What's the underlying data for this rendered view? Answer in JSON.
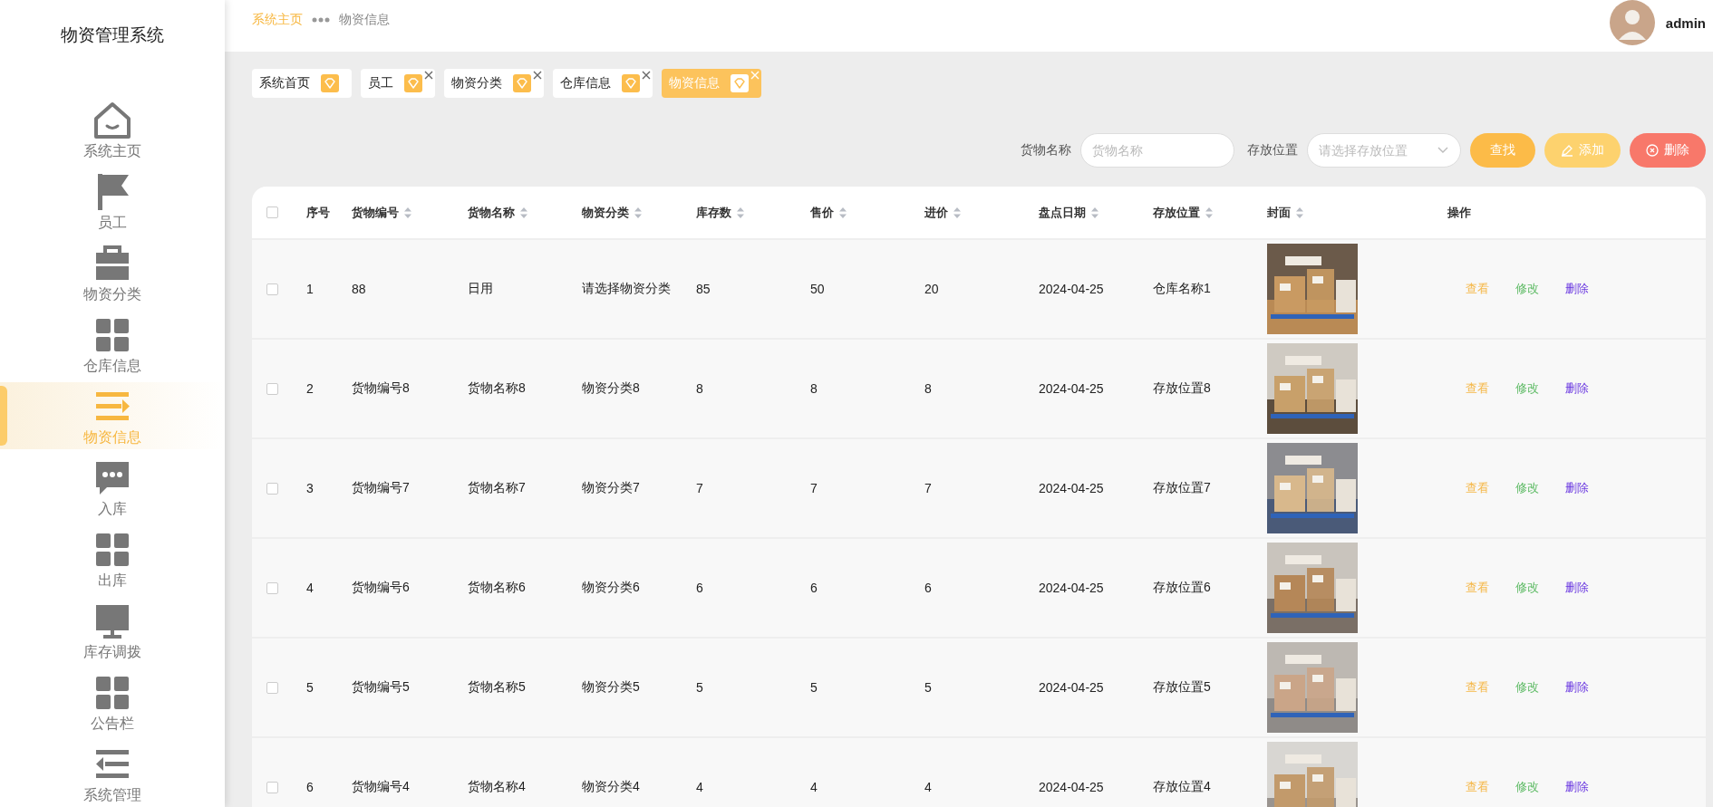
{
  "sidebar": {
    "title": "物资管理系统",
    "items": [
      {
        "label": "系统主页",
        "selected": false
      },
      {
        "label": "员工",
        "selected": false
      },
      {
        "label": "物资分类",
        "selected": false
      },
      {
        "label": "仓库信息",
        "selected": false
      },
      {
        "label": "物资信息",
        "selected": true
      },
      {
        "label": "入库",
        "selected": false
      },
      {
        "label": "出库",
        "selected": false
      },
      {
        "label": "库存调拨",
        "selected": false
      },
      {
        "label": "公告栏",
        "selected": false
      },
      {
        "label": "系统管理",
        "selected": false
      }
    ]
  },
  "breadcrumb": [
    {
      "label": "系统主页",
      "kind": "link"
    },
    {
      "label": "物资信息",
      "kind": "current"
    }
  ],
  "user": {
    "name": "admin"
  },
  "tabs": [
    {
      "label": "系统首页",
      "closable": false,
      "selected": false
    },
    {
      "label": "员工",
      "closable": true,
      "selected": false
    },
    {
      "label": "物资分类",
      "closable": true,
      "selected": false
    },
    {
      "label": "仓库信息",
      "closable": true,
      "selected": false
    },
    {
      "label": "物资信息",
      "closable": true,
      "selected": true
    }
  ],
  "search": {
    "fields": [
      {
        "label": "货物名称",
        "placeholder": "货物名称",
        "kind": "text"
      },
      {
        "label": "存放位置",
        "placeholder": "请选择存放位置",
        "kind": "select"
      }
    ],
    "buttons": [
      {
        "label": "查找",
        "kind": "search"
      },
      {
        "label": "添加",
        "kind": "add"
      },
      {
        "label": "删除",
        "kind": "delete"
      }
    ]
  },
  "table": {
    "select_all": false,
    "columns": [
      {
        "label": "序号",
        "sortable": false
      },
      {
        "label": "货物编号",
        "sortable": true
      },
      {
        "label": "货物名称",
        "sortable": true
      },
      {
        "label": "物资分类",
        "sortable": true
      },
      {
        "label": "库存数",
        "sortable": true
      },
      {
        "label": "售价",
        "sortable": true
      },
      {
        "label": "进价",
        "sortable": true
      },
      {
        "label": "盘点日期",
        "sortable": true
      },
      {
        "label": "存放位置",
        "sortable": true
      },
      {
        "label": "封面",
        "sortable": true
      },
      {
        "label": "操作",
        "sortable": false
      }
    ],
    "rows": [
      {
        "checked": false,
        "cells": [
          "1",
          "88",
          "日用",
          "请选择物资分类",
          "85",
          "50",
          "20",
          "2024-04-25",
          "仓库名称1"
        ],
        "actions": [
          "查看",
          "修改",
          "删除"
        ]
      },
      {
        "checked": false,
        "cells": [
          "2",
          "货物编号8",
          "货物名称8",
          "物资分类8",
          "8",
          "8",
          "8",
          "2024-04-25",
          "存放位置8"
        ],
        "actions": [
          "查看",
          "修改",
          "删除"
        ]
      },
      {
        "checked": false,
        "cells": [
          "3",
          "货物编号7",
          "货物名称7",
          "物资分类7",
          "7",
          "7",
          "7",
          "2024-04-25",
          "存放位置7"
        ],
        "actions": [
          "查看",
          "修改",
          "删除"
        ]
      },
      {
        "checked": false,
        "cells": [
          "4",
          "货物编号6",
          "货物名称6",
          "物资分类6",
          "6",
          "6",
          "6",
          "2024-04-25",
          "存放位置6"
        ],
        "actions": [
          "查看",
          "修改",
          "删除"
        ]
      },
      {
        "checked": false,
        "cells": [
          "5",
          "货物编号5",
          "货物名称5",
          "物资分类5",
          "5",
          "5",
          "5",
          "2024-04-25",
          "存放位置5"
        ],
        "actions": [
          "查看",
          "修改",
          "删除"
        ]
      },
      {
        "checked": false,
        "cells": [
          "6",
          "货物编号4",
          "货物名称4",
          "物资分类4",
          "4",
          "4",
          "4",
          "2024-04-25",
          "存放位置4"
        ],
        "actions": [
          "查看",
          "修改",
          "删除"
        ]
      }
    ]
  }
}
